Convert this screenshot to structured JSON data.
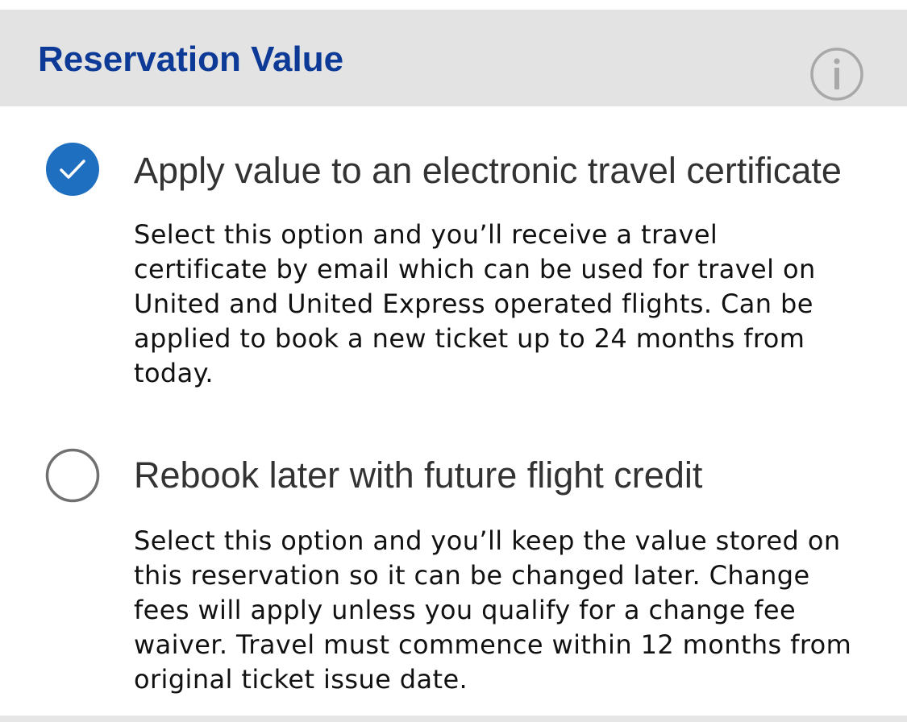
{
  "header": {
    "title": "Reservation Value",
    "info_icon": "info-circle-icon"
  },
  "options": [
    {
      "title": "Apply value to an electronic travel certificate",
      "description": "Select this option and you’ll receive a travel\ncertificate by email which can be used for travel on\nUnited and United Express operated flights. Can be\napplied to book a new ticket up to 24 months from\ntoday.",
      "selected": true
    },
    {
      "title": "Rebook later with future flight credit",
      "description": "Select this option and you’ll keep the value stored on\nthis reservation so it can be changed later. Change\nfees will apply unless you qualify for a change fee\nwaiver. Travel must commence within 12 months from\noriginal ticket issue date.",
      "selected": false
    }
  ],
  "colors": {
    "header_bg": "#e3e3e3",
    "title": "#0c3a96",
    "radio_selected": "#1f6fc0",
    "radio_unselected": "#707070",
    "text": "#333333"
  }
}
